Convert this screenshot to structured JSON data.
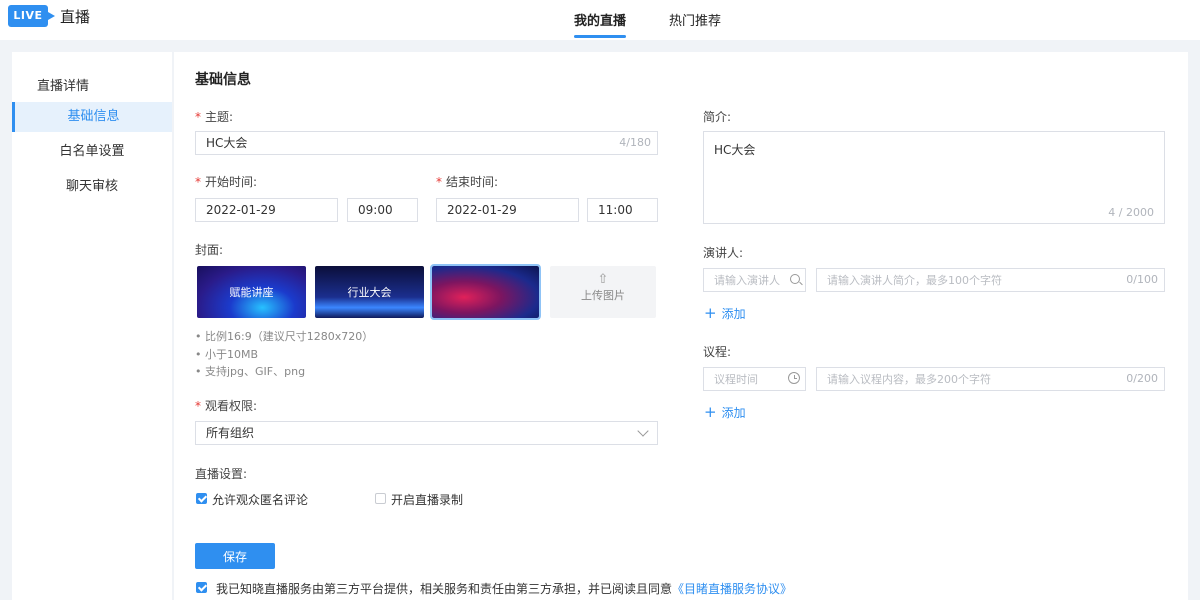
{
  "header": {
    "logo": "LIVE",
    "title": "直播",
    "tabs": [
      {
        "label": "我的直播",
        "active": true
      },
      {
        "label": "热门推荐",
        "active": false
      }
    ]
  },
  "sidebar": {
    "title": "直播详情",
    "items": [
      {
        "label": "基础信息",
        "active": true
      },
      {
        "label": "白名单设置",
        "active": false
      },
      {
        "label": "聊天审核",
        "active": false
      }
    ]
  },
  "form": {
    "section_title": "基础信息",
    "subject": {
      "label": "主题:",
      "value": "HC大会",
      "counter": "4/180"
    },
    "start_time": {
      "label": "开始时间:",
      "date": "2022-01-29",
      "time": "09:00"
    },
    "end_time": {
      "label": "结束时间:",
      "date": "2022-01-29",
      "time": "11:00"
    },
    "cover": {
      "label": "封面:",
      "images": [
        {
          "text": "赋能讲座"
        },
        {
          "text": "行业大会"
        },
        {
          "text": ""
        }
      ],
      "upload_label": "上传图片",
      "hints": [
        "比例16:9（建议尺寸1280x720）",
        "小于10MB",
        "支持jpg、GIF、png"
      ]
    },
    "permission": {
      "label": "观看权限:",
      "value": "所有组织"
    },
    "live_settings": {
      "label": "直播设置:",
      "options": [
        {
          "label": "允许观众匿名评论",
          "checked": true
        },
        {
          "label": "开启直播录制",
          "checked": false
        }
      ]
    },
    "save_label": "保存",
    "agreement": {
      "checked": true,
      "text": "我已知晓直播服务由第三方平台提供，相关服务和责任由第三方承担，并已阅读且同意",
      "link": "《目睹直播服务协议》"
    },
    "intro": {
      "label": "简介:",
      "value": "HC大会",
      "counter": "4 / 2000"
    },
    "speaker": {
      "label": "演讲人:",
      "name_placeholder": "请输入演讲人",
      "desc_placeholder": "请输入演讲人简介，最多100个字符",
      "counter": "0/100",
      "add_label": "添加"
    },
    "agenda": {
      "label": "议程:",
      "time_placeholder": "议程时间",
      "content_placeholder": "请输入议程内容，最多200个字符",
      "counter": "0/200",
      "add_label": "添加"
    }
  },
  "colors": {
    "accent": "#2f8ff0",
    "required": "#e53935",
    "background": "#f0f3f7"
  },
  "icons": [
    "upload-icon",
    "search-icon",
    "clock-icon",
    "chevron-down-icon",
    "plus-icon"
  ]
}
